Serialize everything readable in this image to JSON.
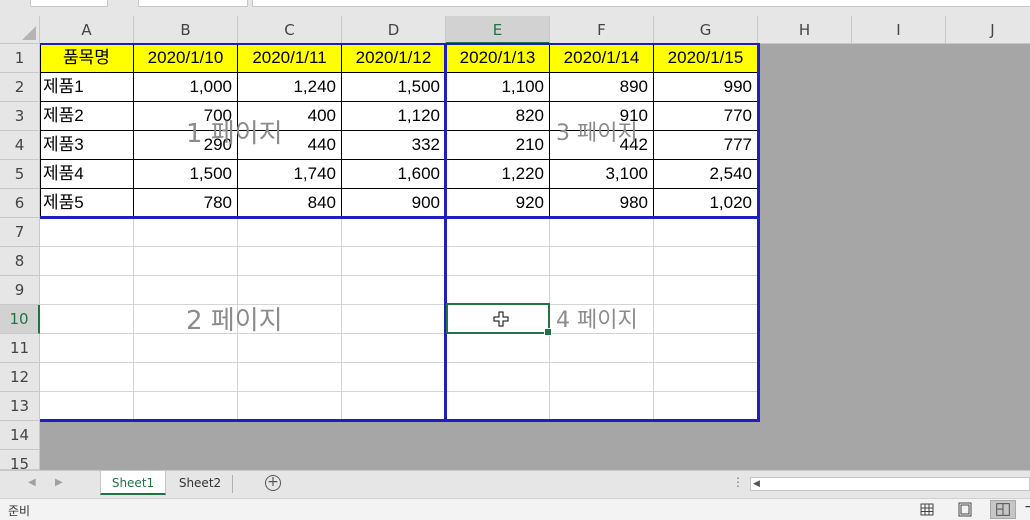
{
  "columns": [
    "A",
    "B",
    "C",
    "D",
    "E",
    "F",
    "G",
    "H",
    "I",
    "J"
  ],
  "rows": [
    "1",
    "2",
    "3",
    "4",
    "5",
    "6",
    "7",
    "8",
    "9",
    "10",
    "11",
    "12",
    "13",
    "14",
    "15"
  ],
  "selected_column": "E",
  "selected_row": "10",
  "table": {
    "header": [
      "품목명",
      "2020/1/10",
      "2020/1/11",
      "2020/1/12",
      "2020/1/13",
      "2020/1/14",
      "2020/1/15"
    ],
    "body": [
      [
        "제품1",
        "1,000",
        "1,240",
        "1,500",
        "1,100",
        "890",
        "990"
      ],
      [
        "제품2",
        "700",
        "400",
        "1,120",
        "820",
        "910",
        "770"
      ],
      [
        "제품3",
        "290",
        "440",
        "332",
        "210",
        "442",
        "777"
      ],
      [
        "제품4",
        "1,500",
        "1,740",
        "1,600",
        "1,220",
        "3,100",
        "2,540"
      ],
      [
        "제품5",
        "780",
        "840",
        "900",
        "920",
        "980",
        "1,020"
      ]
    ]
  },
  "page_labels": [
    "1 페이지",
    "2 페이지",
    "3 페이지",
    "4 페이지"
  ],
  "sheet_tabs": [
    "Sheet1",
    "Sheet2"
  ],
  "active_sheet": "Sheet1",
  "status": "준비",
  "colors": {
    "header_fill": "#ffff00",
    "page_break": "#1f1fbf",
    "selection": "#217346",
    "out_of_print_area": "#a6a6a6"
  },
  "icons": {
    "add_sheet": "plus-circle-icon",
    "view_normal": "grid-icon",
    "view_page_layout": "page-layout-icon",
    "view_page_break": "page-break-preview-icon",
    "cursor": "cell-select-cross-icon"
  }
}
